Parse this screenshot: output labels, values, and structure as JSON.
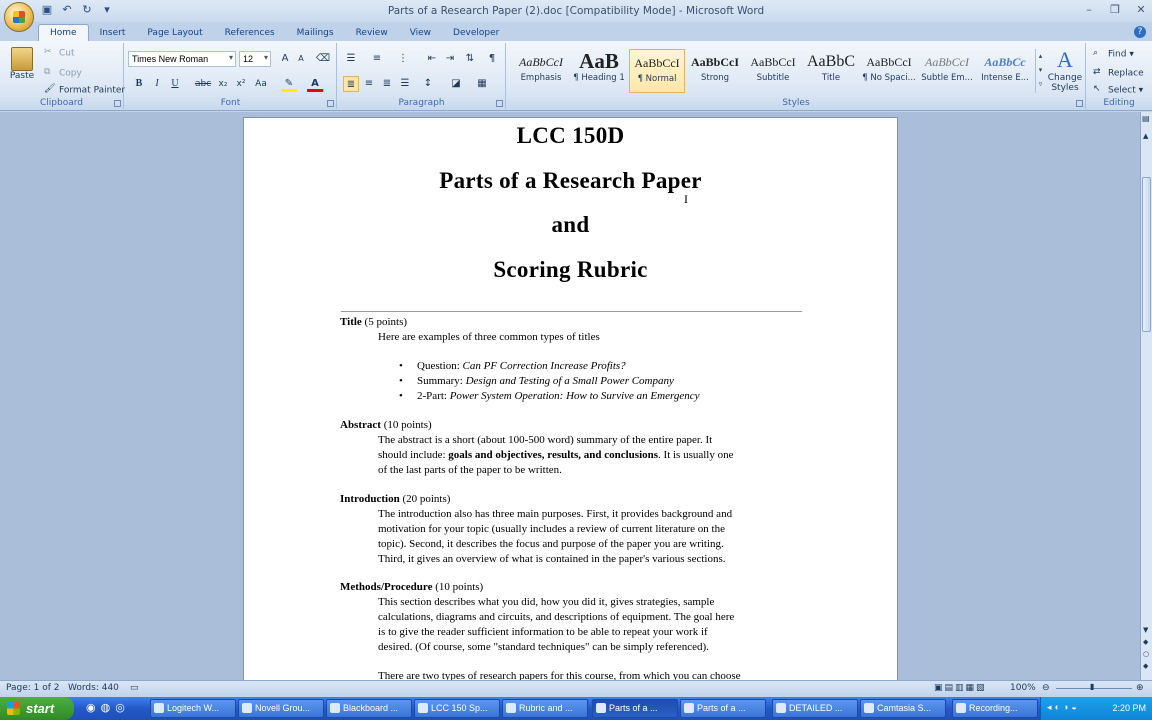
{
  "window": {
    "title": "Parts of a Research Paper (2).doc [Compatibility Mode] - Microsoft Word"
  },
  "tabs": [
    "Home",
    "Insert",
    "Page Layout",
    "References",
    "Mailings",
    "Review",
    "View",
    "Developer"
  ],
  "clipboard": {
    "paste": "Paste",
    "cut": "Cut",
    "copy": "Copy",
    "painter": "Format Painter",
    "label": "Clipboard"
  },
  "font": {
    "name": "Times New Roman",
    "size": "12",
    "label": "Font"
  },
  "paragraph": {
    "label": "Paragraph"
  },
  "styles": {
    "label": "Styles",
    "change": "Change Styles",
    "items": [
      {
        "sample": "AaBbCcI",
        "name": "Emphasis"
      },
      {
        "sample": "AaB",
        "name": "¶ Heading 1"
      },
      {
        "sample": "AaBbCcI",
        "name": "¶ Normal"
      },
      {
        "sample": "AaBbCcI",
        "name": "Strong"
      },
      {
        "sample": "AaBbCcI",
        "name": "Subtitle"
      },
      {
        "sample": "AaBbC",
        "name": "Title"
      },
      {
        "sample": "AaBbCcI",
        "name": "¶ No Spaci..."
      },
      {
        "sample": "AaBbCcI",
        "name": "Subtle Em..."
      },
      {
        "sample": "AaBbCc",
        "name": "Intense E..."
      }
    ]
  },
  "editing": {
    "find": "Find",
    "replace": "Replace",
    "select": "Select",
    "label": "Editing"
  },
  "doc": {
    "h1": "LCC 150D",
    "h2": "Parts of a Research Paper",
    "h3": "and",
    "h4": "Scoring Rubric",
    "title_head": "Title",
    "title_pts": " (5 points)",
    "title_intro": "Here are examples of three common types of titles",
    "b1_lbl": "Question: ",
    "b1_txt": "Can PF Correction Increase Profits?",
    "b2_lbl": "Summary: ",
    "b2_txt": "Design and Testing of a Small Power Company",
    "b3_lbl": "2-Part: ",
    "b3_txt": "Power System Operation: How to Survive an Emergency",
    "abs_head": "Abstract",
    "abs_pts": " (10 points)",
    "abs_l1": "The abstract is a short (about 100-500 word) summary of the entire paper. It",
    "abs_l2a": "should include: ",
    "abs_l2b": "goals and objectives, results, and conclusions",
    "abs_l2c": ".  It is usually one",
    "abs_l3": "of the last parts of the paper to be written.",
    "intro_head": "Introduction",
    "intro_pts": " (20 points)",
    "intro_l1": "The introduction also has three main purposes. First, it provides background and",
    "intro_l2": "motivation for your topic (usually includes a review of current literature on the",
    "intro_l3": "topic). Second, it describes the focus and purpose of the paper you are writing.",
    "intro_l4": "Third, it gives an overview of what is contained in the paper's various sections.",
    "meth_head": "Methods/Procedure",
    "meth_pts": " (10 points)",
    "meth_l1": "This section describes what you did, how you did it, gives strategies, sample",
    "meth_l2": "calculations, diagrams and circuits, and descriptions of equipment. The goal here",
    "meth_l3": "is to give the reader sufficient information to be able to repeat your work if",
    "meth_l4": "desired. (Of course, some \"standard techniques\" can be simply referenced).",
    "meth_l5": "There are two types of research papers for this course, from which you can choose"
  },
  "status": {
    "page": "Page: 1 of 2",
    "words": "Words: 440",
    "zoom": "100%"
  },
  "taskbar": {
    "start": "start",
    "items": [
      "Logitech W...",
      "Novell Grou...",
      "Blackboard ...",
      "LCC 150 Sp...",
      "Rubric and ...",
      "Parts of a ...",
      "Parts of a ...",
      "DETAILED ...",
      "Camtasia S...",
      "Recording..."
    ],
    "time": "2:20 PM"
  }
}
